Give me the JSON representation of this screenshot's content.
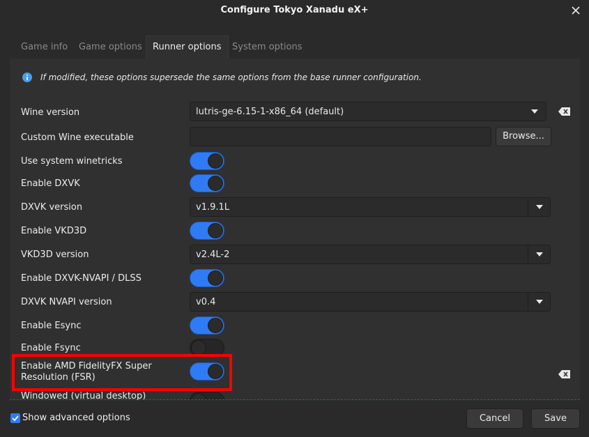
{
  "window": {
    "title": "Configure Tokyo Xanadu eX+"
  },
  "tabs": [
    {
      "label": "Game info",
      "active": false
    },
    {
      "label": "Game options",
      "active": false
    },
    {
      "label": "Runner options",
      "active": true
    },
    {
      "label": "System options",
      "active": false
    }
  ],
  "info": {
    "text": "If modified, these options supersede the same options from the base runner configuration."
  },
  "options": {
    "wine_version": {
      "label": "Wine version",
      "value": "lutris-ge-6.15-1-x86_64 (default)"
    },
    "custom_wine": {
      "label": "Custom Wine executable",
      "value": "",
      "browse_label": "Browse..."
    },
    "system_winetricks": {
      "label": "Use system winetricks",
      "enabled": true
    },
    "enable_dxvk": {
      "label": "Enable DXVK",
      "enabled": true
    },
    "dxvk_version": {
      "label": "DXVK version",
      "value": "v1.9.1L"
    },
    "enable_vkd3d": {
      "label": "Enable VKD3D",
      "enabled": true
    },
    "vkd3d_version": {
      "label": "VKD3D version",
      "value": "v2.4L-2"
    },
    "enable_dxvk_nvapi": {
      "label": "Enable DXVK-NVAPI / DLSS",
      "enabled": true
    },
    "dxvk_nvapi_version": {
      "label": "DXVK NVAPI version",
      "value": "v0.4"
    },
    "enable_esync": {
      "label": "Enable Esync",
      "enabled": true
    },
    "enable_fsync": {
      "label": "Enable Fsync",
      "enabled": false
    },
    "enable_fsr": {
      "label": "Enable AMD FidelityFX Super Resolution (FSR)",
      "enabled": true
    },
    "windowed": {
      "label": "Windowed (virtual desktop)"
    }
  },
  "footer": {
    "show_advanced_label": "Show advanced options",
    "show_advanced_checked": true,
    "cancel_label": "Cancel",
    "save_label": "Save"
  },
  "colors": {
    "accent": "#2f7bf5",
    "highlight": "#ff0000"
  }
}
